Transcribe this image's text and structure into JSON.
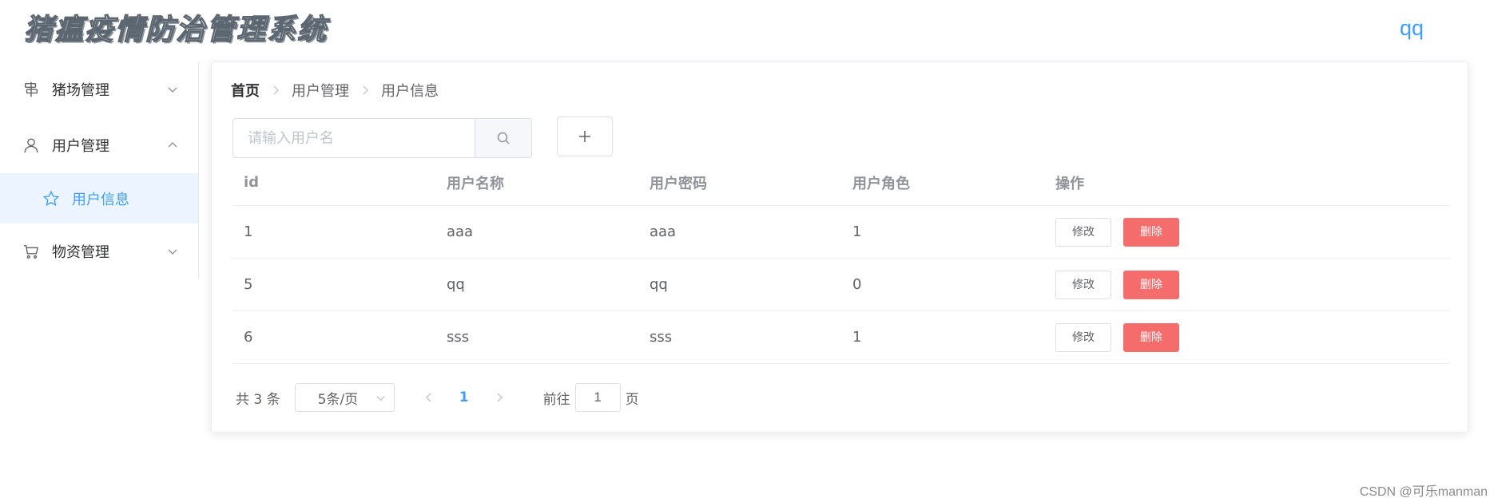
{
  "header": {
    "app_title": "猪瘟疫情防治管理系统",
    "user_name": "qq"
  },
  "sidebar": {
    "items": [
      {
        "label": "猪场管理",
        "icon": "signpost-icon",
        "expanded": false
      },
      {
        "label": "用户管理",
        "icon": "user-icon",
        "expanded": true
      },
      {
        "label": "物资管理",
        "icon": "cart-icon",
        "expanded": false
      }
    ],
    "subitems": [
      {
        "label": "用户信息",
        "icon": "star-icon",
        "active": true
      }
    ]
  },
  "breadcrumb": [
    "首页",
    "用户管理",
    "用户信息"
  ],
  "search": {
    "placeholder": "请输入用户名",
    "value": ""
  },
  "table": {
    "columns": [
      "id",
      "用户名称",
      "用户密码",
      "用户角色",
      "操作"
    ],
    "rows": [
      {
        "id": "1",
        "name": "aaa",
        "password": "aaa",
        "role": "1"
      },
      {
        "id": "5",
        "name": "qq",
        "password": "qq",
        "role": "0"
      },
      {
        "id": "6",
        "name": "sss",
        "password": "sss",
        "role": "1"
      }
    ],
    "edit_label": "修改",
    "delete_label": "删除"
  },
  "pagination": {
    "total_text": "共 3 条",
    "page_size": "5条/页",
    "current_page": "1",
    "goto_prefix": "前往",
    "goto_value": "1",
    "goto_suffix": "页"
  },
  "watermark": "CSDN @可乐manman",
  "colors": {
    "primary": "#409eff",
    "danger": "#f56c6c",
    "active_bg": "#ecf5ff"
  }
}
